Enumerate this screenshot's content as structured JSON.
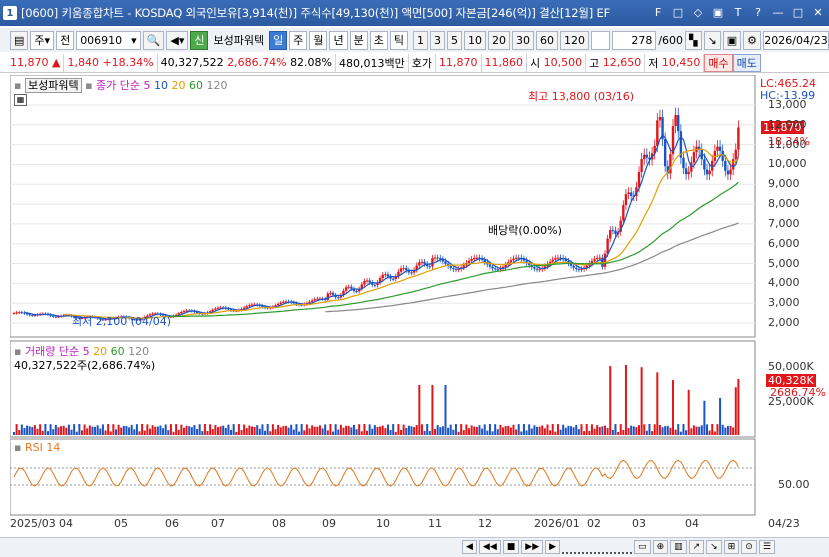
{
  "window": {
    "number": "1",
    "title": "[0600] 키움종합차트 - KOSDAQ 외국인보유[3,914(천)] 주식수[49,130(천)] 액면[500] 자본금[246(억)] 결산[12월] EF",
    "buttons": [
      "F",
      "□",
      "◇",
      "▣",
      "T",
      "?",
      "—",
      "□",
      "✕"
    ]
  },
  "toolbar": {
    "market_label": "주",
    "all_label": "전",
    "code": "006910",
    "credit_badge": "신",
    "stock_name": "보성파워텍",
    "periods": [
      "일",
      "주",
      "월",
      "년",
      "분",
      "초",
      "틱"
    ],
    "active_period": "일",
    "intervals": [
      "1",
      "3",
      "5",
      "10",
      "20",
      "30",
      "60",
      "120"
    ],
    "count": "278",
    "count_total": "/600",
    "date": "2026/04/23"
  },
  "info": {
    "price": "11,870",
    "change": "1,840",
    "change_pct": "+18.34%",
    "volume": "40,327,522",
    "volume_pct": "2,686.74%",
    "ratio": "82.08%",
    "amount": "480,013백만",
    "quote_label": "호가",
    "ask": "11,870",
    "bid": "11,860",
    "open_label": "시",
    "open": "10,500",
    "high_label": "고",
    "high": "12,650",
    "low_label": "저",
    "low": "10,450",
    "buy_label": "매수",
    "sell_label": "매도"
  },
  "price_panel": {
    "name_tag": "보성파워텍",
    "legend_prefix": "종가 단순",
    "ma": [
      {
        "label": "5",
        "color": "#1b53c4"
      },
      {
        "label": "10",
        "color": "#1b53c4"
      },
      {
        "label": "20",
        "color": "#e0a000"
      },
      {
        "label": "60",
        "color": "#2e9a2e"
      },
      {
        "label": "120",
        "color": "#888888"
      }
    ],
    "lc": "LC:465.24",
    "hc": "HC:-13.99",
    "high_marker": "최고 13,800 (03/16)",
    "low_marker": "최저 2,100 (04/04)",
    "dividend_marker": "배당락(0.00%)",
    "current_box": "11,870",
    "current_pct": "18.34%",
    "y_ticks": [
      "13,000",
      "12,000",
      "11,000",
      "10,000",
      "9,000",
      "8,000",
      "7,000",
      "6,000",
      "5,000",
      "4,000",
      "3,000",
      "2,000"
    ]
  },
  "volume_panel": {
    "title": "거래량",
    "legend_prefix": "단순",
    "ma": [
      {
        "label": "5",
        "color": "#c020c0"
      },
      {
        "label": "20",
        "color": "#e0a000"
      },
      {
        "label": "60",
        "color": "#2e9a2e"
      },
      {
        "label": "120",
        "color": "#888888"
      }
    ],
    "sub": "40,327,522주(2,686.74%)",
    "y_ticks": [
      "50,000K",
      "25,000K"
    ],
    "current_box": "40,328K",
    "current_pct": "2686.74%"
  },
  "rsi_panel": {
    "title": "RSI 14",
    "y_ticks": [
      "50.00"
    ]
  },
  "x_axis": {
    "labels": [
      "2025/03",
      "04",
      "05",
      "06",
      "07",
      "08",
      "09",
      "10",
      "11",
      "12",
      "2026/01",
      "02",
      "03",
      "04"
    ],
    "right_label": "04/23"
  },
  "colors": {
    "up": "#e0161b",
    "down": "#1b53c4",
    "ma5": "#1b53c4",
    "ma20": "#e0a000",
    "ma60": "#2e9a2e",
    "ma120": "#888888",
    "rsi": "#e07820"
  }
}
